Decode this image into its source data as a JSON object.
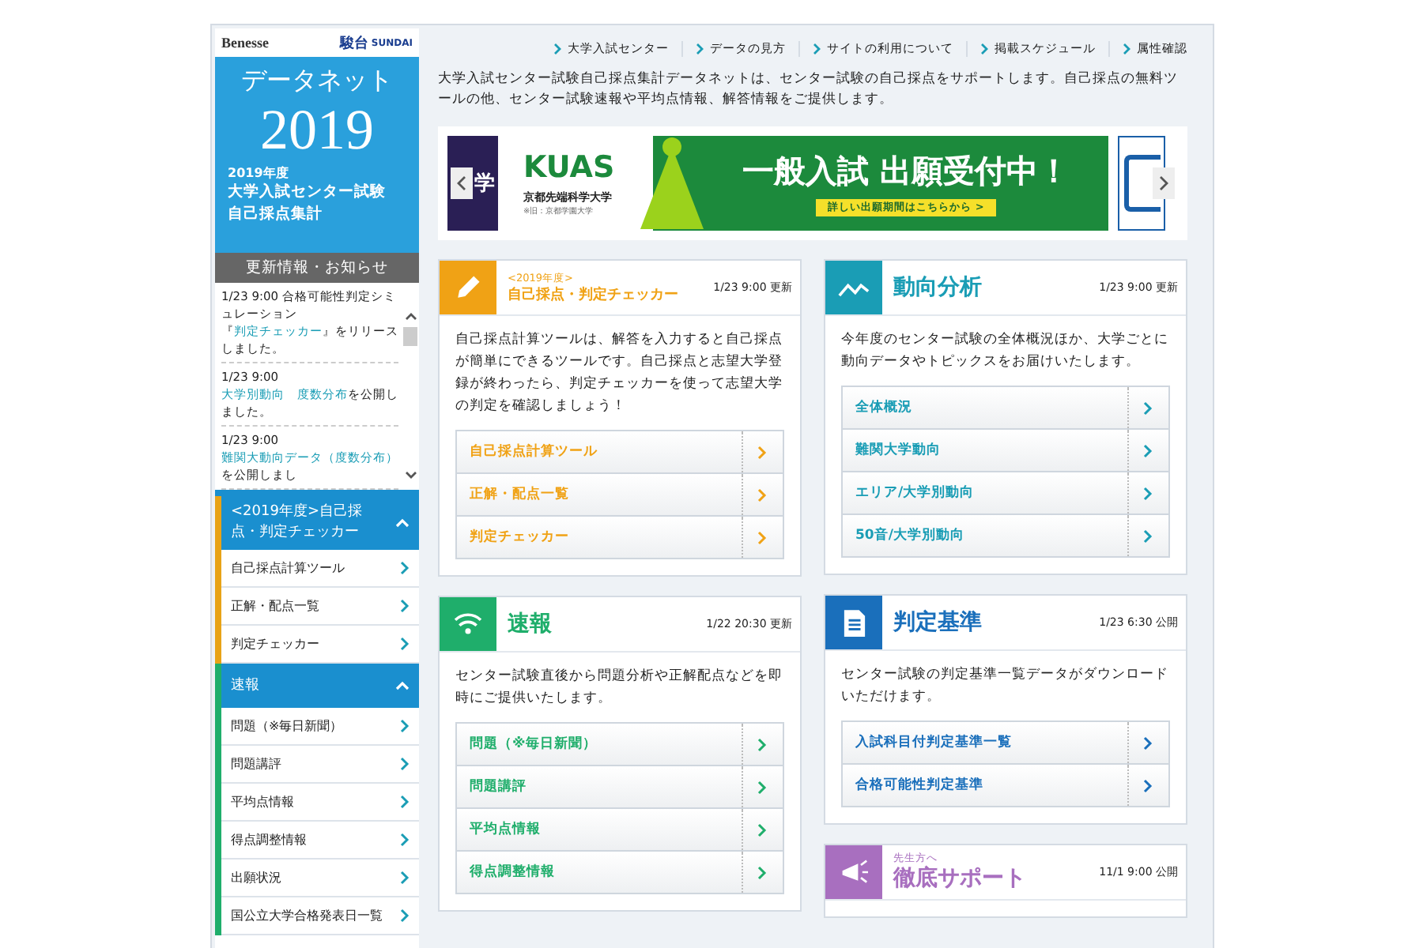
{
  "sidebar": {
    "logos": [
      "Benesse",
      "駿台",
      "SUNDAI"
    ],
    "hero": {
      "title": "データネット",
      "year": "2019",
      "subtitle": "2019年度",
      "lines": [
        "大学入試センター試験",
        "自己採点集計"
      ]
    },
    "news_header": "更新情報・お知らせ",
    "news": [
      {
        "date": "1/23 9:00",
        "segments": [
          {
            "kind": "text",
            "text": "合格可能性判定シミュレーション『"
          },
          {
            "kind": "link",
            "text": "判定チェッカー"
          },
          {
            "kind": "text",
            "text": "』をリリースしました。"
          }
        ]
      },
      {
        "date": "1/23 9:00",
        "segments": [
          {
            "kind": "link",
            "text": "大学別動向　度数分布"
          },
          {
            "kind": "text",
            "text": "を公開しました。"
          }
        ]
      },
      {
        "date": "1/23 9:00",
        "segments": [
          {
            "kind": "link",
            "text": "難関大動向データ（度数分布）"
          },
          {
            "kind": "text",
            "text": "を公開しまし"
          }
        ]
      }
    ],
    "sections": [
      {
        "title": "<2019年度>自己採点・判定チェッカー",
        "color": "#e8a317",
        "expanded": true,
        "items": [
          "自己採点計算ツール",
          "正解・配点一覧",
          "判定チェッカー"
        ]
      },
      {
        "title": "速報",
        "color": "#1fae6b",
        "expanded": true,
        "items": [
          "問題（※毎日新聞）",
          "問題講評",
          "平均点情報",
          "得点調整情報",
          "出願状況",
          "国公立大学合格発表日一覧"
        ]
      }
    ]
  },
  "top_links": [
    "大学入試センター",
    "データの見方",
    "サイトの利用について",
    "掲載スケジュール",
    "属性確認"
  ],
  "intro": "大学入試センター試験自己採点集計データネットは、センター試験の自己採点をサポートします。自己採点の無料ツールの他、センター試験速報や平均点情報、解答情報をご提供します。",
  "carousel": {
    "left_partial": "学",
    "ad": {
      "logo": "KUAS",
      "university": "京都先端科学大学",
      "note": "※旧：京都学園大学",
      "headline": "一般入試 出願受付中！",
      "cta": "詳しい出願期間はこちらから >"
    }
  },
  "card_columns": [
    [
      {
        "kind": "pencil",
        "color": "#f0a215",
        "subtitle": "<2019年度>",
        "title": "自己採点・判定チェッカー",
        "date": "1/23 9:00 更新",
        "description": "自己採点計算ツールは、解答を入力すると自己採点が簡単にできるツールです。自己採点と志望大学登録が終わったら、判定チェッカーを使って志望大学の判定を確認しましょう！",
        "links": [
          "自己採点計算ツール",
          "正解・配点一覧",
          "判定チェッカー"
        ]
      },
      {
        "kind": "wifi",
        "color": "#1fae6b",
        "title": "速報",
        "date": "1/22 20:30 更新",
        "description": "センター試験直後から問題分析や正解配点などを即時にご提供いたします。",
        "links": [
          "問題（※毎日新聞）",
          "問題講評",
          "平均点情報",
          "得点調整情報"
        ]
      }
    ],
    [
      {
        "kind": "chart",
        "color": "#1a9db5",
        "title": "動向分析",
        "date": "1/23 9:00 更新",
        "description": "今年度のセンター試験の全体概況ほか、大学ごとに動向データやトピックスをお届けいたします。",
        "links": [
          "全体概況",
          "難関大学動向",
          "エリア/大学別動向",
          "50音/大学別動向"
        ]
      },
      {
        "kind": "document",
        "color": "#1a6fbb",
        "title": "判定基準",
        "date": "1/23 6:30 公開",
        "description": "センター試験の判定基準一覧データがダウンロードいただけます。",
        "links": [
          "入試科目付判定基準一覧",
          "合格可能性判定基準"
        ]
      },
      {
        "kind": "megaphone",
        "color": "#a86fbf",
        "subtitle": "先生方へ",
        "title": "徹底サポート",
        "date": "11/1 9:00 公開"
      }
    ]
  ]
}
